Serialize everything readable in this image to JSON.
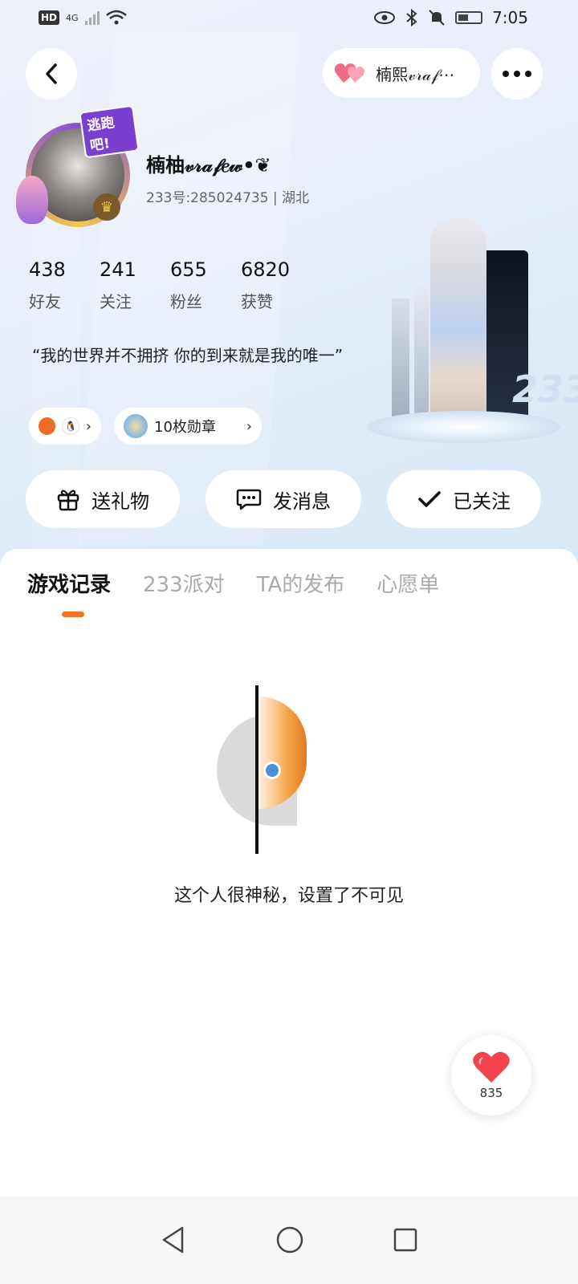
{
  "status_bar": {
    "hd": "HD",
    "network": "4G",
    "time": "7:05"
  },
  "header": {
    "cp_name": "楠熙𝓋𝓇𝒶𝒻⋯"
  },
  "profile": {
    "avatar_badge": "逃跑吧!",
    "username": "楠柚𝓋𝓇𝒶𝒻𝑒𝓌•❦",
    "user_id": "233号:285024735 | 湖北",
    "stats": [
      {
        "value": "438",
        "label": "好友"
      },
      {
        "value": "241",
        "label": "关注"
      },
      {
        "value": "655",
        "label": "粉丝"
      },
      {
        "value": "6820",
        "label": "获赞"
      }
    ],
    "bio": "“我的世界并不拥挤 你的到来就是我的唯一”",
    "medal_label": "10枚勋章",
    "figure_label": "233"
  },
  "actions": {
    "gift": "送礼物",
    "message": "发消息",
    "follow": "已关注"
  },
  "tabs": [
    {
      "label": "游戏记录",
      "active": true
    },
    {
      "label": "233派对",
      "active": false
    },
    {
      "label": "TA的发布",
      "active": false
    },
    {
      "label": "心愿单",
      "active": false
    }
  ],
  "empty_state": {
    "text": "这个人很神秘，设置了不可见"
  },
  "like": {
    "count": "835"
  },
  "colors": {
    "accent": "#f47321",
    "heart": "#f0434c"
  }
}
